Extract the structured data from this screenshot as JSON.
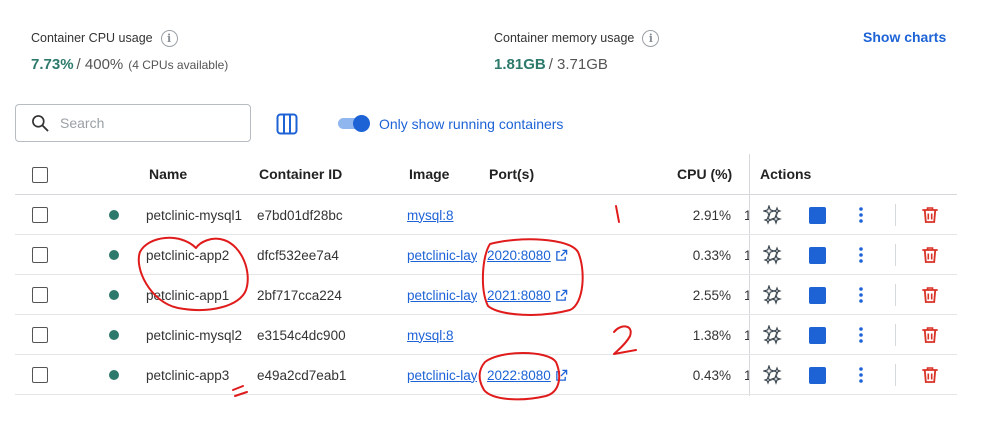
{
  "stats": {
    "cpu": {
      "label": "Container CPU usage",
      "value": "7.73%",
      "total": "/ 400%",
      "sub": "(4 CPUs available)"
    },
    "memory": {
      "label": "Container memory usage",
      "value": "1.81GB",
      "total": "/ 3.71GB"
    },
    "show_charts": "Show charts"
  },
  "toolbar": {
    "search_placeholder": "Search",
    "toggle_label": "Only show running containers"
  },
  "table": {
    "headers": {
      "name": "Name",
      "container_id": "Container ID",
      "image": "Image",
      "ports": "Port(s)",
      "cpu": "CPU (%)",
      "actions": "Actions"
    },
    "rows": [
      {
        "name": "petclinic-mysql1",
        "id": "e7bd01df28bc",
        "image": "mysql:8",
        "port": "",
        "cpu": "2.91%",
        "tail": "1"
      },
      {
        "name": "petclinic-app2",
        "id": "dfcf532ee7a4",
        "image": "petclinic-layered",
        "port": "2020:8080",
        "cpu": "0.33%",
        "tail": "1"
      },
      {
        "name": "petclinic-app1",
        "id": "2bf717cca224",
        "image": "petclinic-layered",
        "port": "2021:8080",
        "cpu": "2.55%",
        "tail": "1"
      },
      {
        "name": "petclinic-mysql2",
        "id": "e3154c4dc900",
        "image": "mysql:8",
        "port": "",
        "cpu": "1.38%",
        "tail": "1"
      },
      {
        "name": "petclinic-app3",
        "id": "e49a2cd7eab1",
        "image": "petclinic-layered",
        "port": "2022:8080",
        "cpu": "0.43%",
        "tail": "1"
      }
    ]
  },
  "colors": {
    "accent": "#1d63d6",
    "running": "#2d7a6c",
    "delete": "#d93025",
    "annotation": "#e01b1b"
  },
  "icons": {
    "search": "search-icon",
    "columns": "columns-icon",
    "info": "info-icon",
    "external": "external-link-icon",
    "sparkles": "sparkles-icon",
    "stop": "stop-icon",
    "more": "more-vert-icon",
    "delete": "trash-icon"
  }
}
